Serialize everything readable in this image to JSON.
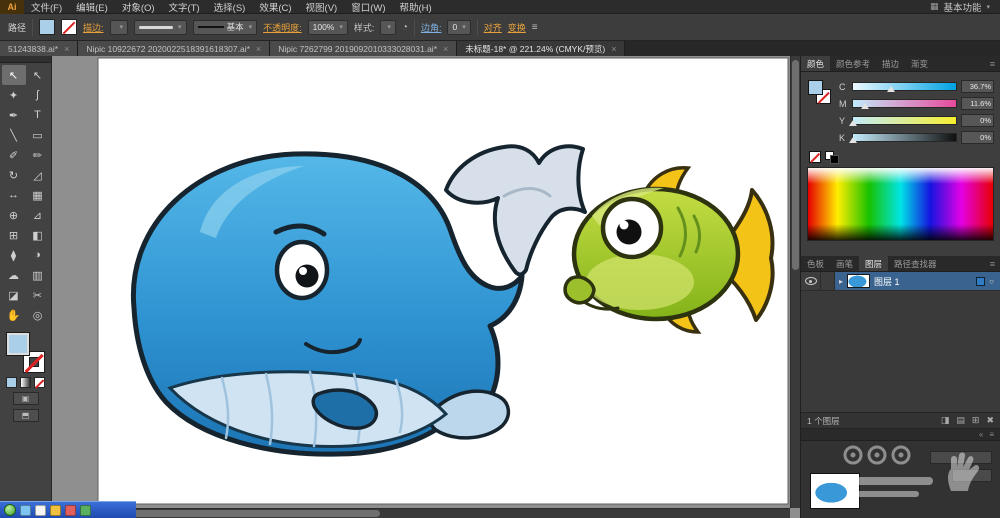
{
  "icons": {
    "chevron": "▾",
    "close": "×",
    "menu": "≡",
    "recolor": "◔",
    "disclosure": "▸",
    "target": "○",
    "workspace": "▦",
    "collapse": "«"
  },
  "menu_bar": {
    "logo": "Ai",
    "items": [
      "文件(F)",
      "编辑(E)",
      "对象(O)",
      "文字(T)",
      "选择(S)",
      "效果(C)",
      "视图(V)",
      "窗口(W)",
      "帮助(H)"
    ],
    "workspace_label": "基本功能"
  },
  "control_bar": {
    "context_label": "路径",
    "stroke_link": "描边:",
    "stroke_width_value": "",
    "brush_value": "基本",
    "opacity_link": "不透明度:",
    "opacity_value": "100%",
    "style_label": "样式:",
    "corner_label": "边角:",
    "corner_value": "0",
    "align_link": "对齐",
    "transform_link": "变换"
  },
  "document_tabs": [
    {
      "label": "51243838.ai*",
      "active": false
    },
    {
      "label": "Nipic 10922672 2020022518391618307.ai*",
      "active": false
    },
    {
      "label": "Nipic 7262799 2019092010333028031.ai*",
      "active": false
    },
    {
      "label": "未标题-18* @ 221.24% (CMYK/预览)",
      "active": true
    }
  ],
  "toolbar": {
    "tools": [
      {
        "name": "selection-tool",
        "glyph": "↖",
        "active": true
      },
      {
        "name": "direct-selection-tool",
        "glyph": "↖",
        "active": false
      },
      {
        "name": "magic-wand-tool",
        "glyph": "✦",
        "active": false
      },
      {
        "name": "lasso-tool",
        "glyph": "ʃ",
        "active": false
      },
      {
        "name": "pen-tool",
        "glyph": "✒",
        "active": false
      },
      {
        "name": "type-tool",
        "glyph": "T",
        "active": false
      },
      {
        "name": "line-segment-tool",
        "glyph": "╲",
        "active": false
      },
      {
        "name": "rectangle-tool",
        "glyph": "▭",
        "active": false
      },
      {
        "name": "paintbrush-tool",
        "glyph": "✐",
        "active": false
      },
      {
        "name": "pencil-tool",
        "glyph": "✏",
        "active": false
      },
      {
        "name": "rotate-tool",
        "glyph": "↻",
        "active": false
      },
      {
        "name": "scale-tool",
        "glyph": "◿",
        "active": false
      },
      {
        "name": "width-tool",
        "glyph": "↔",
        "active": false
      },
      {
        "name": "free-transform-tool",
        "glyph": "▦",
        "active": false
      },
      {
        "name": "shape-builder-tool",
        "glyph": "⊕",
        "active": false
      },
      {
        "name": "perspective-grid-tool",
        "glyph": "⊿",
        "active": false
      },
      {
        "name": "mesh-tool",
        "glyph": "⊞",
        "active": false
      },
      {
        "name": "gradient-tool",
        "glyph": "◧",
        "active": false
      },
      {
        "name": "eyedropper-tool",
        "glyph": "⧫",
        "active": false
      },
      {
        "name": "blend-tool",
        "glyph": "◑",
        "active": false
      },
      {
        "name": "symbol-sprayer-tool",
        "glyph": "☁",
        "active": false
      },
      {
        "name": "column-graph-tool",
        "glyph": "▥",
        "active": false
      },
      {
        "name": "artboard-tool",
        "glyph": "◪",
        "active": false
      },
      {
        "name": "slice-tool",
        "glyph": "✂",
        "active": false
      },
      {
        "name": "hand-tool",
        "glyph": "✋",
        "active": false
      },
      {
        "name": "zoom-tool",
        "glyph": "◎",
        "active": false
      }
    ]
  },
  "color_panel": {
    "tabs": [
      {
        "label": "颜色",
        "active": true
      },
      {
        "label": "颜色参考",
        "active": false
      },
      {
        "label": "描边",
        "active": false
      },
      {
        "label": "渐变",
        "active": false
      }
    ],
    "channels": [
      {
        "label": "C",
        "value": "36.7%",
        "percent": 36.7,
        "from": "#eef9ff",
        "to": "#00a2e2"
      },
      {
        "label": "M",
        "value": "11.6%",
        "percent": 11.6,
        "from": "#c3ebfb",
        "to": "#e84a9b"
      },
      {
        "label": "Y",
        "value": "0%",
        "percent": 0,
        "from": "#c3ebfb",
        "to": "#f6ee30"
      },
      {
        "label": "K",
        "value": "0%",
        "percent": 0,
        "from": "#c3ebfb",
        "to": "#101010"
      }
    ],
    "fill_color": "#aacfe8"
  },
  "layers_panel": {
    "tabs": [
      {
        "label": "色板",
        "active": false
      },
      {
        "label": "画笔",
        "active": false
      },
      {
        "label": "图层",
        "active": true
      },
      {
        "label": "路径查找器",
        "active": false
      }
    ],
    "layers": [
      {
        "name": "图层 1"
      }
    ],
    "status": "1 个图层",
    "footer_icons": [
      {
        "name": "make-clipping-mask-icon",
        "glyph": "◨"
      },
      {
        "name": "new-sublayer-icon",
        "glyph": "▤"
      },
      {
        "name": "new-layer-icon",
        "glyph": "⊞"
      },
      {
        "name": "delete-layer-icon",
        "glyph": "✖"
      }
    ]
  },
  "artwork": {
    "whale_color": "#2f93d2",
    "whale_belly_color": "#cfe3f2",
    "whale_tail_color": "#d7e0ea",
    "fish_color": "#9cc02c",
    "fish_fin_color": "#f4c318",
    "outline_color": "#15242e"
  }
}
